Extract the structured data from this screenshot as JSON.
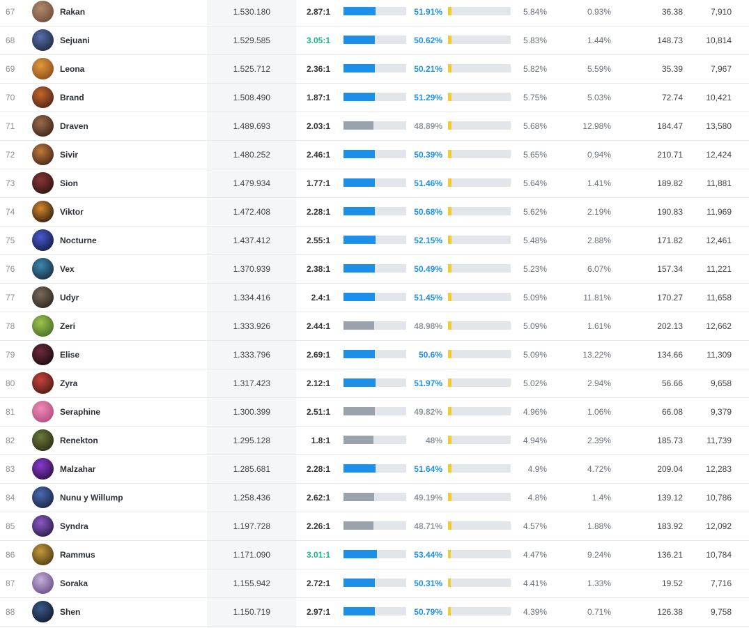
{
  "colors": {
    "win_bar_positive": "#1c8fe8",
    "win_bar_negative": "#9aa3ad",
    "kda_high": "#1eb68c",
    "secondary_bar": "#f5cb2c",
    "bar_track": "#e2e6ea"
  },
  "rows": [
    {
      "rank": "67",
      "champion": "Rakan",
      "avatar": "rakan-portrait-icon",
      "score": "1.530.180",
      "kda": "2.87:1",
      "kda_high": false,
      "winrate": "51.91%",
      "win_fill": 0.51,
      "win_positive": true,
      "secondary_fill": 0.06,
      "pick": "5.84%",
      "ban": "0.93%",
      "avg1": "36.38",
      "avg2": "7,910",
      "tint": [
        "#b08a6a",
        "#6d4b3c"
      ]
    },
    {
      "rank": "68",
      "champion": "Sejuani",
      "avatar": "sejuani-portrait-icon",
      "score": "1.529.585",
      "kda": "3.05:1",
      "kda_high": true,
      "winrate": "50.62%",
      "win_fill": 0.5,
      "win_positive": true,
      "secondary_fill": 0.06,
      "pick": "5.83%",
      "ban": "1.44%",
      "avg1": "148.73",
      "avg2": "10,814",
      "tint": [
        "#5a6ea8",
        "#1e2740"
      ]
    },
    {
      "rank": "69",
      "champion": "Leona",
      "avatar": "leona-portrait-icon",
      "score": "1.525.712",
      "kda": "2.36:1",
      "kda_high": false,
      "winrate": "50.21%",
      "win_fill": 0.5,
      "win_positive": true,
      "secondary_fill": 0.06,
      "pick": "5.82%",
      "ban": "5.59%",
      "avg1": "35.39",
      "avg2": "7,967",
      "tint": [
        "#e09a3c",
        "#8a4a1c"
      ]
    },
    {
      "rank": "70",
      "champion": "Brand",
      "avatar": "brand-portrait-icon",
      "score": "1.508.490",
      "kda": "1.87:1",
      "kda_high": false,
      "winrate": "51.29%",
      "win_fill": 0.5,
      "win_positive": true,
      "secondary_fill": 0.06,
      "pick": "5.75%",
      "ban": "5.03%",
      "avg1": "72.74",
      "avg2": "10,421",
      "tint": [
        "#c4662e",
        "#4a2414"
      ]
    },
    {
      "rank": "71",
      "champion": "Draven",
      "avatar": "draven-portrait-icon",
      "score": "1.489.693",
      "kda": "2.03:1",
      "kda_high": false,
      "winrate": "48.89%",
      "win_fill": 0.48,
      "win_positive": false,
      "secondary_fill": 0.06,
      "pick": "5.68%",
      "ban": "12.98%",
      "avg1": "184.47",
      "avg2": "13,580",
      "tint": [
        "#9a6a4a",
        "#3a2418"
      ]
    },
    {
      "rank": "72",
      "champion": "Sivir",
      "avatar": "sivir-portrait-icon",
      "score": "1.480.252",
      "kda": "2.46:1",
      "kda_high": false,
      "winrate": "50.39%",
      "win_fill": 0.5,
      "win_positive": true,
      "secondary_fill": 0.06,
      "pick": "5.65%",
      "ban": "0.94%",
      "avg1": "210.71",
      "avg2": "12,424",
      "tint": [
        "#c27a3a",
        "#3e2418"
      ]
    },
    {
      "rank": "73",
      "champion": "Sion",
      "avatar": "sion-portrait-icon",
      "score": "1.479.934",
      "kda": "1.77:1",
      "kda_high": false,
      "winrate": "51.46%",
      "win_fill": 0.5,
      "win_positive": true,
      "secondary_fill": 0.06,
      "pick": "5.64%",
      "ban": "1.41%",
      "avg1": "189.82",
      "avg2": "11,881",
      "tint": [
        "#8a3434",
        "#2a1414"
      ]
    },
    {
      "rank": "74",
      "champion": "Viktor",
      "avatar": "viktor-portrait-icon",
      "score": "1.472.408",
      "kda": "2.28:1",
      "kda_high": false,
      "winrate": "50.68%",
      "win_fill": 0.5,
      "win_positive": true,
      "secondary_fill": 0.06,
      "pick": "5.62%",
      "ban": "2.19%",
      "avg1": "190.83",
      "avg2": "11,969",
      "tint": [
        "#d8882c",
        "#2a1c10"
      ]
    },
    {
      "rank": "75",
      "champion": "Nocturne",
      "avatar": "nocturne-portrait-icon",
      "score": "1.437.412",
      "kda": "2.55:1",
      "kda_high": false,
      "winrate": "52.15%",
      "win_fill": 0.51,
      "win_positive": true,
      "secondary_fill": 0.05,
      "pick": "5.48%",
      "ban": "2.88%",
      "avg1": "171.82",
      "avg2": "12,461",
      "tint": [
        "#4a5ad0",
        "#141a40"
      ]
    },
    {
      "rank": "76",
      "champion": "Vex",
      "avatar": "vex-portrait-icon",
      "score": "1.370.939",
      "kda": "2.38:1",
      "kda_high": false,
      "winrate": "50.49%",
      "win_fill": 0.5,
      "win_positive": true,
      "secondary_fill": 0.05,
      "pick": "5.23%",
      "ban": "6.07%",
      "avg1": "157.34",
      "avg2": "11,221",
      "tint": [
        "#3a8ab0",
        "#1a2a3a"
      ]
    },
    {
      "rank": "77",
      "champion": "Udyr",
      "avatar": "udyr-portrait-icon",
      "score": "1.334.416",
      "kda": "2.4:1",
      "kda_high": false,
      "winrate": "51.45%",
      "win_fill": 0.5,
      "win_positive": true,
      "secondary_fill": 0.05,
      "pick": "5.09%",
      "ban": "11.81%",
      "avg1": "170.27",
      "avg2": "11,658",
      "tint": [
        "#7a6a5a",
        "#2a2420"
      ]
    },
    {
      "rank": "78",
      "champion": "Zeri",
      "avatar": "zeri-portrait-icon",
      "score": "1.333.926",
      "kda": "2.44:1",
      "kda_high": false,
      "winrate": "48.98%",
      "win_fill": 0.49,
      "win_positive": false,
      "secondary_fill": 0.05,
      "pick": "5.09%",
      "ban": "1.61%",
      "avg1": "202.13",
      "avg2": "12,662",
      "tint": [
        "#9ac44a",
        "#4a6a2a"
      ]
    },
    {
      "rank": "79",
      "champion": "Elise",
      "avatar": "elise-portrait-icon",
      "score": "1.333.796",
      "kda": "2.69:1",
      "kda_high": false,
      "winrate": "50.6%",
      "win_fill": 0.5,
      "win_positive": true,
      "secondary_fill": 0.05,
      "pick": "5.09%",
      "ban": "13.22%",
      "avg1": "134.66",
      "avg2": "11,309",
      "tint": [
        "#6a2a3a",
        "#1a0a10"
      ]
    },
    {
      "rank": "80",
      "champion": "Zyra",
      "avatar": "zyra-portrait-icon",
      "score": "1.317.423",
      "kda": "2.12:1",
      "kda_high": false,
      "winrate": "51.97%",
      "win_fill": 0.51,
      "win_positive": true,
      "secondary_fill": 0.05,
      "pick": "5.02%",
      "ban": "2.94%",
      "avg1": "56.66",
      "avg2": "9,658",
      "tint": [
        "#c4443a",
        "#4a1a14"
      ]
    },
    {
      "rank": "81",
      "champion": "Seraphine",
      "avatar": "seraphine-portrait-icon",
      "score": "1.300.399",
      "kda": "2.51:1",
      "kda_high": false,
      "winrate": "49.82%",
      "win_fill": 0.5,
      "win_positive": false,
      "secondary_fill": 0.05,
      "pick": "4.96%",
      "ban": "1.06%",
      "avg1": "66.08",
      "avg2": "9,379",
      "tint": [
        "#f08ab8",
        "#b04a7a"
      ]
    },
    {
      "rank": "82",
      "champion": "Renekton",
      "avatar": "renekton-portrait-icon",
      "score": "1.295.128",
      "kda": "1.8:1",
      "kda_high": false,
      "winrate": "48%",
      "win_fill": 0.48,
      "win_positive": false,
      "secondary_fill": 0.05,
      "pick": "4.94%",
      "ban": "2.39%",
      "avg1": "185.73",
      "avg2": "11,739",
      "tint": [
        "#6a7a3a",
        "#2a2a14"
      ]
    },
    {
      "rank": "83",
      "champion": "Malzahar",
      "avatar": "malzahar-portrait-icon",
      "score": "1.285.681",
      "kda": "2.28:1",
      "kda_high": false,
      "winrate": "51.64%",
      "win_fill": 0.51,
      "win_positive": true,
      "secondary_fill": 0.05,
      "pick": "4.9%",
      "ban": "4.72%",
      "avg1": "209.04",
      "avg2": "12,283",
      "tint": [
        "#8a3ad0",
        "#2a1040"
      ]
    },
    {
      "rank": "84",
      "champion": "Nunu y Willump",
      "avatar": "nunu-portrait-icon",
      "score": "1.258.436",
      "kda": "2.62:1",
      "kda_high": false,
      "winrate": "49.19%",
      "win_fill": 0.49,
      "win_positive": false,
      "secondary_fill": 0.05,
      "pick": "4.8%",
      "ban": "1.4%",
      "avg1": "139.12",
      "avg2": "10,786",
      "tint": [
        "#4a6ab0",
        "#1a2440"
      ]
    },
    {
      "rank": "85",
      "champion": "Syndra",
      "avatar": "syndra-portrait-icon",
      "score": "1.197.728",
      "kda": "2.26:1",
      "kda_high": false,
      "winrate": "48.71%",
      "win_fill": 0.48,
      "win_positive": false,
      "secondary_fill": 0.05,
      "pick": "4.57%",
      "ban": "1.88%",
      "avg1": "183.92",
      "avg2": "12,092",
      "tint": [
        "#8a5ac4",
        "#2a1a44"
      ]
    },
    {
      "rank": "86",
      "champion": "Rammus",
      "avatar": "rammus-portrait-icon",
      "score": "1.171.090",
      "kda": "3.01:1",
      "kda_high": true,
      "winrate": "53.44%",
      "win_fill": 0.53,
      "win_positive": true,
      "secondary_fill": 0.04,
      "pick": "4.47%",
      "ban": "9.24%",
      "avg1": "136.21",
      "avg2": "10,784",
      "tint": [
        "#c49a3a",
        "#4a3a14"
      ]
    },
    {
      "rank": "87",
      "champion": "Soraka",
      "avatar": "soraka-portrait-icon",
      "score": "1.155.942",
      "kda": "2.72:1",
      "kda_high": false,
      "winrate": "50.31%",
      "win_fill": 0.5,
      "win_positive": true,
      "secondary_fill": 0.04,
      "pick": "4.41%",
      "ban": "1.33%",
      "avg1": "19.52",
      "avg2": "7,716",
      "tint": [
        "#c4b0d8",
        "#6a4a8a"
      ]
    },
    {
      "rank": "88",
      "champion": "Shen",
      "avatar": "shen-portrait-icon",
      "score": "1.150.719",
      "kda": "2.97:1",
      "kda_high": false,
      "winrate": "50.79%",
      "win_fill": 0.5,
      "win_positive": true,
      "secondary_fill": 0.04,
      "pick": "4.39%",
      "ban": "0.71%",
      "avg1": "126.38",
      "avg2": "9,758",
      "tint": [
        "#3a5a8a",
        "#101a2a"
      ]
    }
  ]
}
